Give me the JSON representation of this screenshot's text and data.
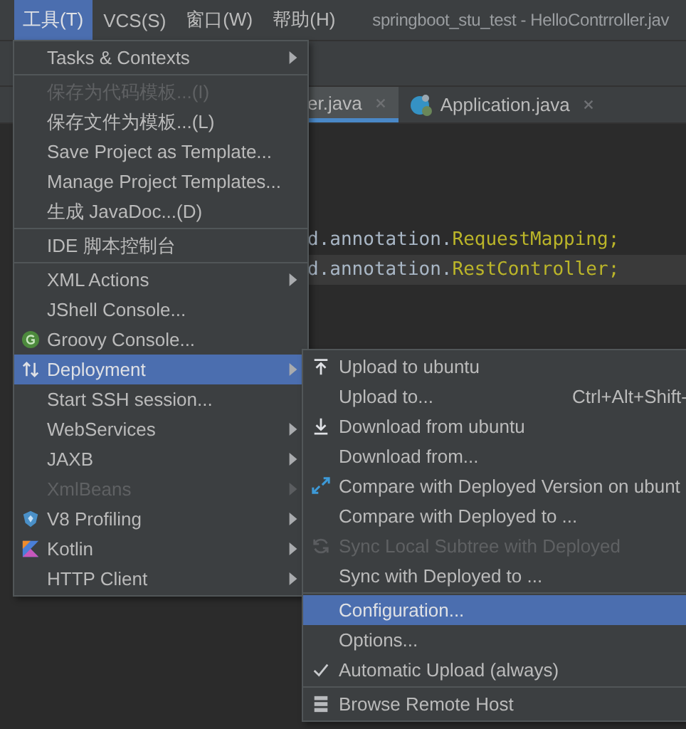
{
  "menubar": {
    "items": [
      {
        "label": "工具(T)",
        "selected": true
      },
      {
        "label": "VCS(S)",
        "selected": false
      },
      {
        "label": "窗口(W)",
        "selected": false
      },
      {
        "label": "帮助(H)",
        "selected": false
      }
    ],
    "title": "springboot_stu_test - HelloContrroller.jav"
  },
  "tabs": [
    {
      "label": "er.java",
      "selected": true
    },
    {
      "label": "Application.java",
      "kind": "class",
      "selected": false
    }
  ],
  "code_lines": [
    {
      "current": false,
      "parts": [
        {
          "text": "d.annotation.",
          "kind": "plain"
        },
        {
          "text": "RequestMapping;",
          "kind": "class"
        }
      ]
    },
    {
      "current": true,
      "parts": [
        {
          "text": "d.annotation.",
          "kind": "plain"
        },
        {
          "text": "RestController;",
          "kind": "class"
        }
      ]
    }
  ],
  "tools_menu": {
    "groups": [
      [
        {
          "label": "Tasks & Contexts",
          "submenu": true,
          "disabled": false,
          "selected": false
        }
      ],
      [
        {
          "label": "保存为代码模板...(I)",
          "submenu": false,
          "disabled": true,
          "selected": false
        },
        {
          "label": "保存文件为模板...(L)",
          "submenu": false,
          "disabled": false,
          "selected": false
        },
        {
          "label": "Save Project as Template...",
          "submenu": false,
          "disabled": false,
          "selected": false
        },
        {
          "label": "Manage Project Templates...",
          "submenu": false,
          "disabled": false,
          "selected": false
        },
        {
          "label": "生成 JavaDoc...(D)",
          "submenu": false,
          "disabled": false,
          "selected": false
        }
      ],
      [
        {
          "label": "IDE 脚本控制台",
          "submenu": false,
          "disabled": false,
          "selected": false
        }
      ],
      [
        {
          "label": "XML Actions",
          "submenu": true,
          "disabled": false,
          "selected": false
        },
        {
          "label": "JShell Console...",
          "submenu": false,
          "disabled": false,
          "selected": false
        },
        {
          "label": "Groovy Console...",
          "kind": "groovy",
          "submenu": false,
          "disabled": false,
          "selected": false
        },
        {
          "label": "Deployment",
          "kind": "deploy",
          "submenu": true,
          "disabled": false,
          "selected": true
        },
        {
          "label": "Start SSH session...",
          "submenu": false,
          "disabled": false,
          "selected": false
        },
        {
          "label": "WebServices",
          "submenu": true,
          "disabled": false,
          "selected": false
        },
        {
          "label": "JAXB",
          "submenu": true,
          "disabled": false,
          "selected": false
        },
        {
          "label": "XmlBeans",
          "submenu": true,
          "disabled": true,
          "selected": false
        },
        {
          "label": "V8 Profiling",
          "kind": "v8",
          "submenu": true,
          "disabled": false,
          "selected": false
        },
        {
          "label": "Kotlin",
          "kind": "kotlin",
          "submenu": true,
          "disabled": false,
          "selected": false
        },
        {
          "label": "HTTP Client",
          "submenu": true,
          "disabled": false,
          "selected": false
        }
      ]
    ]
  },
  "deployment_menu": {
    "groups": [
      [
        {
          "label": "Upload to ubuntu",
          "kind": "upload",
          "checked": false,
          "disabled": false,
          "selected": false
        },
        {
          "label": "Upload to...",
          "shortcut": "Ctrl+Alt+Shift-",
          "checked": false,
          "disabled": false,
          "selected": false
        },
        {
          "label": "Download from ubuntu",
          "kind": "download",
          "checked": false,
          "disabled": false,
          "selected": false
        },
        {
          "label": "Download from...",
          "checked": false,
          "disabled": false,
          "selected": false
        },
        {
          "label": "Compare with Deployed Version on ubunt",
          "kind": "compare",
          "checked": false,
          "disabled": false,
          "selected": false
        },
        {
          "label": "Compare with Deployed to ...",
          "checked": false,
          "disabled": false,
          "selected": false
        },
        {
          "label": "Sync Local Subtree with Deployed",
          "kind": "sync",
          "checked": false,
          "disabled": true,
          "selected": false
        },
        {
          "label": "Sync with Deployed to ...",
          "checked": false,
          "disabled": false,
          "selected": false
        }
      ],
      [
        {
          "label": "Configuration...",
          "checked": false,
          "disabled": false,
          "selected": true
        },
        {
          "label": "Options...",
          "checked": false,
          "disabled": false,
          "selected": false
        },
        {
          "label": "Automatic Upload (always)",
          "checked": true,
          "disabled": false,
          "selected": false
        }
      ],
      [
        {
          "label": "Browse Remote Host",
          "kind": "browse",
          "checked": false,
          "disabled": false,
          "selected": false
        }
      ]
    ]
  }
}
